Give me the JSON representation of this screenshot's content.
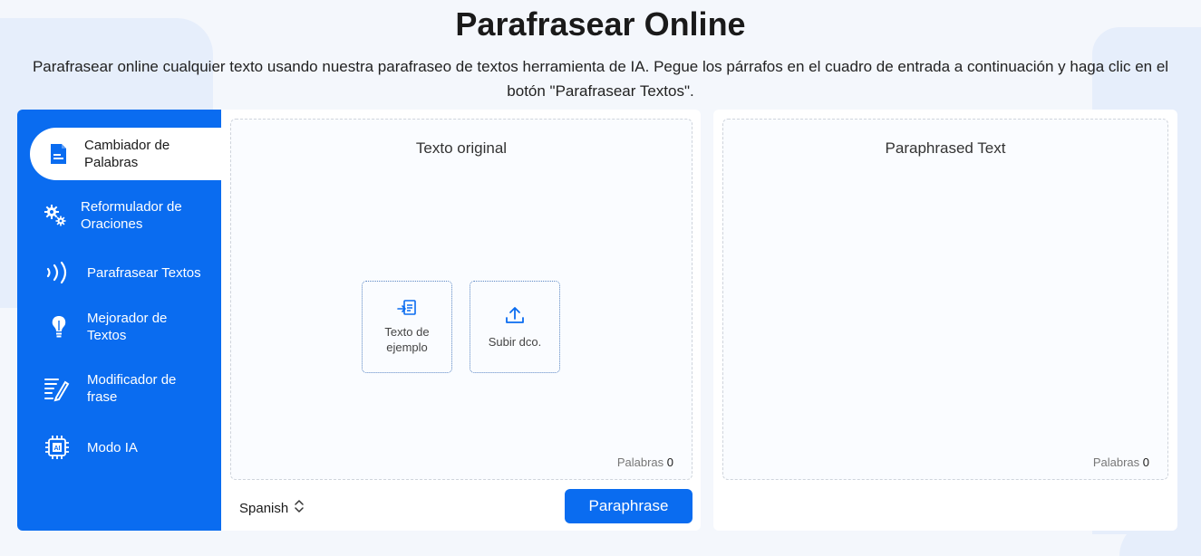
{
  "header": {
    "title": "Parafrasear Online",
    "subtitle_line1": "Parafrasear online cualquier texto usando nuestra parafraseo de textos herramienta de IA. Pegue los párrafos en el cuadro de entrada a continuación y haga clic en el",
    "subtitle_line2": "botón \"Parafrasear Textos\"."
  },
  "sidebar": {
    "items": [
      {
        "label_line1": "Cambiador de",
        "label_line2": "Palabras",
        "icon": "document-icon",
        "active": true
      },
      {
        "label_line1": "Reformulador de",
        "label_line2": "Oraciones",
        "icon": "gears-icon"
      },
      {
        "label_line1": "Parafrasear Textos",
        "label_line2": "",
        "icon": "sound-waves-icon"
      },
      {
        "label_line1": "Mejorador de",
        "label_line2": "Textos",
        "icon": "lightbulb-icon"
      },
      {
        "label_line1": "Modificador de",
        "label_line2": "frase",
        "icon": "pen-list-icon"
      },
      {
        "label_line1": "Modo IA",
        "label_line2": "",
        "icon": "ai-chip-icon"
      }
    ]
  },
  "input_panel": {
    "title": "Texto original",
    "sample_button_line1": "Texto de",
    "sample_button_line2": "ejemplo",
    "upload_button": "Subir dco.",
    "words_label": "Palabras",
    "words_count": "0",
    "language": "Spanish",
    "paraphrase_button": "Paraphrase"
  },
  "output_panel": {
    "title": "Paraphrased Text",
    "words_label": "Palabras",
    "words_count": "0"
  },
  "colors": {
    "primary": "#0a6cf0",
    "background": "#f4f7fc",
    "panel": "#ffffff"
  }
}
